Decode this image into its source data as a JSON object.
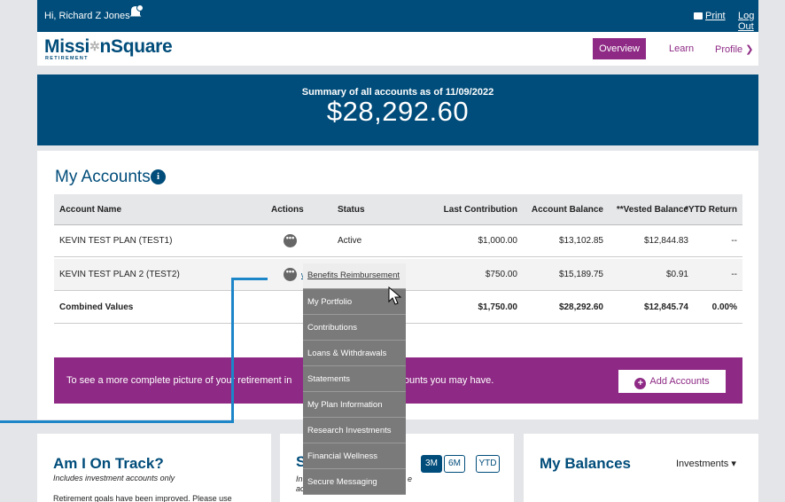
{
  "topbar": {
    "greeting": "Hi, Richard Z Jones",
    "print": "Print",
    "logout": "Log Out"
  },
  "brand": {
    "logo_main": "MissionSquare",
    "logo_sub": "RETIREMENT"
  },
  "nav": {
    "overview": "Overview",
    "learn": "Learn",
    "profile": "Profile ❯"
  },
  "summary": {
    "label": "Summary of all accounts as of 11/09/2022",
    "amount": "$28,292.60"
  },
  "accounts": {
    "title": "My Accounts",
    "info_glyph": "i",
    "headers": [
      "Account Name",
      "Actions",
      "Status",
      "Last Contribution",
      "Account Balance",
      "**Vested Balance",
      "*YTD Return"
    ],
    "rows": [
      {
        "name": "KEVIN TEST PLAN (TEST1)",
        "status": "Active",
        "last": "$1,000.00",
        "balance": "$13,102.85",
        "vested": "$12,844.83",
        "ytd": "--"
      },
      {
        "name": "KEVIN TEST PLAN 2 (TEST2)",
        "status": "",
        "last": "$750.00",
        "balance": "$15,189.75",
        "vested": "$0.91",
        "ytd": "--"
      }
    ],
    "combined": {
      "name": "Combined Values",
      "last": "$1,750.00",
      "balance": "$28,292.60",
      "vested": "$12,845.74",
      "ytd": "0.00%"
    },
    "trunc_link": "w"
  },
  "banner": {
    "text_left": "To see a more complete picture of your retirement in",
    "text_right": "counts you may have.",
    "add_button": "Add Accounts"
  },
  "menu": {
    "items": [
      "Benefits Reimbursement",
      "My Portfolio",
      "Contributions",
      "Loans & Withdrawals",
      "Statements",
      "My Plan Information",
      "Research Investments",
      "Financial Wellness",
      "Secure Messaging"
    ]
  },
  "track": {
    "title": "Am I On Track?",
    "sub": "Includes investment accounts only",
    "body": "Retirement goals have been improved. Please use"
  },
  "mid": {
    "title_letter": "S",
    "sub1": "In",
    "sub2": "ac",
    "tail": "e",
    "periods": [
      "3M",
      "6M",
      "YTD"
    ]
  },
  "balances": {
    "title": "My Balances",
    "selector": "Investments ▾"
  },
  "colors": {
    "navy": "#004c7a",
    "purple": "#8e2a85",
    "callout": "#1c86c9",
    "menu_gray": "#7a7a7b"
  }
}
